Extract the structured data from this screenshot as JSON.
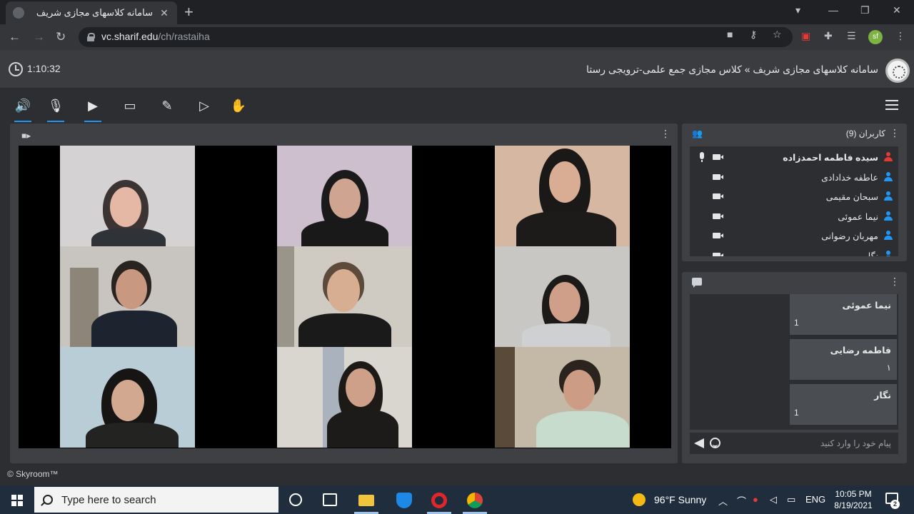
{
  "browser": {
    "tab_title": "سامانه کلاسهای مجازی شریف",
    "new_tab": "+",
    "url_host": "vc.sharif.edu",
    "url_path": "/ch/rastaiha",
    "profile_initials": "sf"
  },
  "header": {
    "timer": "1:10:32",
    "breadcrumb": "سامانه کلاسهای مجازی شریف » کلاس مجازی جمع علمی-ترویجی رستا"
  },
  "toolbar": {
    "icons": [
      "speaker-icon",
      "microphone-icon",
      "camera-icon",
      "screen-share-icon",
      "brush-icon",
      "play-icon",
      "raise-hand-icon"
    ],
    "active_color": "#2196f3"
  },
  "users_panel": {
    "title": "کاربران (9)",
    "users": [
      {
        "name": "سیده فاطمه احمدزاده",
        "host": true,
        "mic": true,
        "camera": true
      },
      {
        "name": "عاطفه خدادادی",
        "host": false,
        "mic": false,
        "camera": true
      },
      {
        "name": "سبحان مقیمی",
        "host": false,
        "mic": false,
        "camera": true
      },
      {
        "name": "نیما عموئی",
        "host": false,
        "mic": false,
        "camera": true
      },
      {
        "name": "مهربان رضوانی",
        "host": false,
        "mic": false,
        "camera": true
      },
      {
        "name": "نگار",
        "host": false,
        "mic": false,
        "camera": true
      }
    ],
    "host_color": "#e53935",
    "user_color": "#2196f3"
  },
  "chat": {
    "messages": [
      {
        "author": "نیما عموئی",
        "text": "1",
        "rtl": false
      },
      {
        "author": "فاطمه رضایی",
        "text": "۱",
        "rtl": true
      },
      {
        "author": "نگار",
        "text": "1",
        "rtl": false
      }
    ],
    "placeholder": "پیام خود را وارد کنید"
  },
  "footer": {
    "copyright": "© Skyroom™"
  },
  "taskbar": {
    "search_placeholder": "Type here to search",
    "weather": "96°F  Sunny",
    "language": "ENG",
    "time": "10:05 PM",
    "date": "8/19/2021",
    "notifications": "2"
  }
}
